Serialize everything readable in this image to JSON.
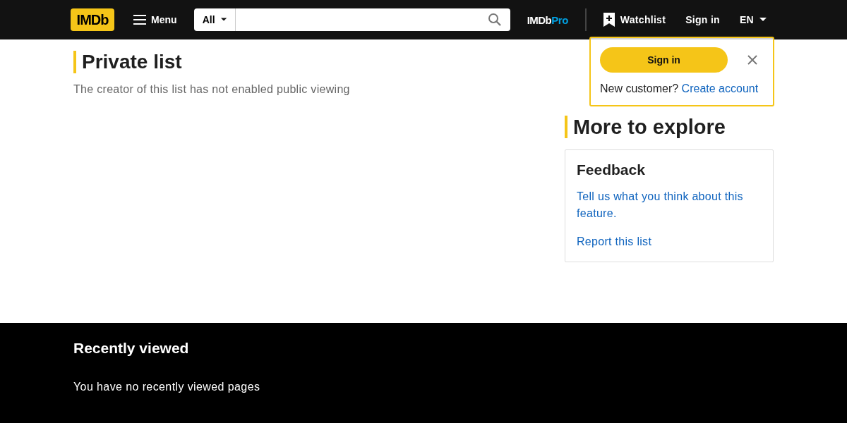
{
  "header": {
    "logo": "IMDb",
    "menu": "Menu",
    "search_category": "All",
    "pro_logo": {
      "main": "IMDb",
      "accent": "Pro"
    },
    "watchlist": "Watchlist",
    "sign_in": "Sign in",
    "language": "EN"
  },
  "main": {
    "title": "Private list",
    "subtitle": "The creator of this list has not enabled public viewing"
  },
  "sidebar": {
    "title": "More to explore",
    "card": {
      "title": "Feedback",
      "links": [
        "Tell us what you think about this feature.",
        "Report this list"
      ]
    }
  },
  "popup": {
    "button": "Sign in",
    "prompt": "New customer?",
    "link": "Create account"
  },
  "footer": {
    "title": "Recently viewed",
    "message": "You have no recently viewed pages"
  }
}
